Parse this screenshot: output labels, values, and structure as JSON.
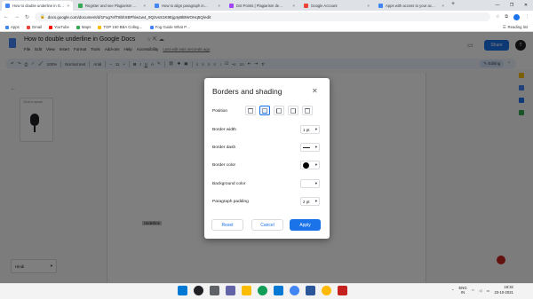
{
  "browser": {
    "tabs": [
      {
        "title": "How to double underline in G…",
        "color": "#4285f4",
        "active": true
      },
      {
        "title": "Register and see Plagiarism …",
        "color": "#34a853",
        "active": false
      },
      {
        "title": "How to align paragraph in…",
        "color": "#4285f4",
        "active": false
      },
      {
        "title": "Dot Points | Plagiarism de…",
        "color": "#a142f4",
        "active": false
      },
      {
        "title": "Google Account",
        "color": "#ea4335",
        "active": false
      },
      {
        "title": "Apps with access to your ac…",
        "color": "#4285f4",
        "active": false
      }
    ],
    "new_tab": "+",
    "url": "docs.google.com/document/d/1Fug7efT6bhXBPhiw1w4_9Q2vsS1K9Ejg4yBlBWOHq5Q/edit",
    "bookmarks": [
      {
        "label": "Apps",
        "color": "#4285f4"
      },
      {
        "label": "Gmail",
        "color": "#ea4335"
      },
      {
        "label": "YouTube",
        "color": "#ff0000"
      },
      {
        "label": "Maps",
        "color": "#34a853"
      },
      {
        "label": "TOP 150 BBA Colleg…",
        "color": "#fbbc04"
      },
      {
        "label": "Fog Guide What P…",
        "color": "#4285f4"
      }
    ],
    "reading_list": "Reading list"
  },
  "docs": {
    "title": "How to double underline in Google Docs",
    "menu": [
      "File",
      "Edit",
      "View",
      "Insert",
      "Format",
      "Tools",
      "Add-ons",
      "Help",
      "Accessibility"
    ],
    "last_edit": "Last edit was seconds ago",
    "share_label": "Share",
    "avatar_letter": "T",
    "toolbar": {
      "zoom": "100%",
      "style": "Normal text",
      "font": "Arial",
      "size": "11",
      "editing": "Editing"
    },
    "voice_label": "Click to speak",
    "language": "Hindi",
    "highlighted_word": "Underline"
  },
  "dialog": {
    "title": "Borders and shading",
    "position_label": "Position",
    "rows": [
      {
        "label": "Border width",
        "value": "1 pt"
      },
      {
        "label": "Border dash",
        "value": ""
      },
      {
        "label": "Border color",
        "value": ""
      },
      {
        "label": "Background color",
        "value": ""
      },
      {
        "label": "Paragraph padding",
        "value": "2 pt"
      }
    ],
    "buttons": {
      "reset": "Reset",
      "cancel": "Cancel",
      "apply": "Apply"
    },
    "accent_color": "#1a73e8"
  },
  "taskbar": {
    "lang": "ENG",
    "lang2": "IN",
    "time": "18:32",
    "date": "23-10-2021"
  }
}
